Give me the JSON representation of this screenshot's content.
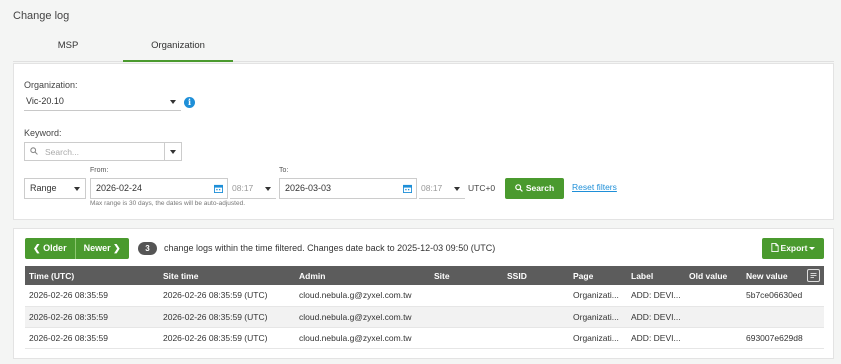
{
  "page": {
    "title": "Change log"
  },
  "tabs": [
    {
      "label": "MSP"
    },
    {
      "label": "Organization"
    }
  ],
  "filters": {
    "organization_label": "Organization:",
    "organization_value": "Vic-20.10",
    "keyword_label": "Keyword:",
    "keyword_placeholder": "Search...",
    "range_value": "Range",
    "from_label": "From:",
    "from_date": "2026-02-24",
    "from_time": "08:17",
    "to_label": "To:",
    "to_date": "2026-03-03",
    "to_time": "08:17",
    "timezone": "UTC+0",
    "range_hint": "Max range is 30 days, the dates will be auto-adjusted.",
    "search_label": "Search",
    "reset_label": "Reset filters"
  },
  "results": {
    "older_label": "Older",
    "newer_label": "Newer",
    "count": "3",
    "summary": "change logs within the time filtered. Changes date back to 2025-12-03 09:50 (UTC)",
    "export_label": "Export",
    "columns": [
      "Time (UTC)",
      "Site time",
      "Admin",
      "Site",
      "SSID",
      "Page",
      "Label",
      "Old value",
      "New value"
    ],
    "rows": [
      [
        "2026-02-26 08:35:59",
        "2026-02-26 08:35:59 (UTC)",
        "cloud.nebula.g@zyxel.com.tw",
        "",
        "",
        "Organizati...",
        "ADD: DEVI...",
        "",
        "5b7ce06630ed"
      ],
      [
        "2026-02-26 08:35:59",
        "2026-02-26 08:35:59 (UTC)",
        "cloud.nebula.g@zyxel.com.tw",
        "",
        "",
        "Organizati...",
        "ADD: DEVI...",
        "",
        ""
      ],
      [
        "2026-02-26 08:35:59",
        "2026-02-26 08:35:59 (UTC)",
        "cloud.nebula.g@zyxel.com.tw",
        "",
        "",
        "Organizati...",
        "ADD: DEVI...",
        "",
        "693007e629d8"
      ]
    ]
  },
  "colors": {
    "accent": "#4a9a2e",
    "link": "#1e8fd8",
    "header_bg": "#5c5c5c"
  }
}
